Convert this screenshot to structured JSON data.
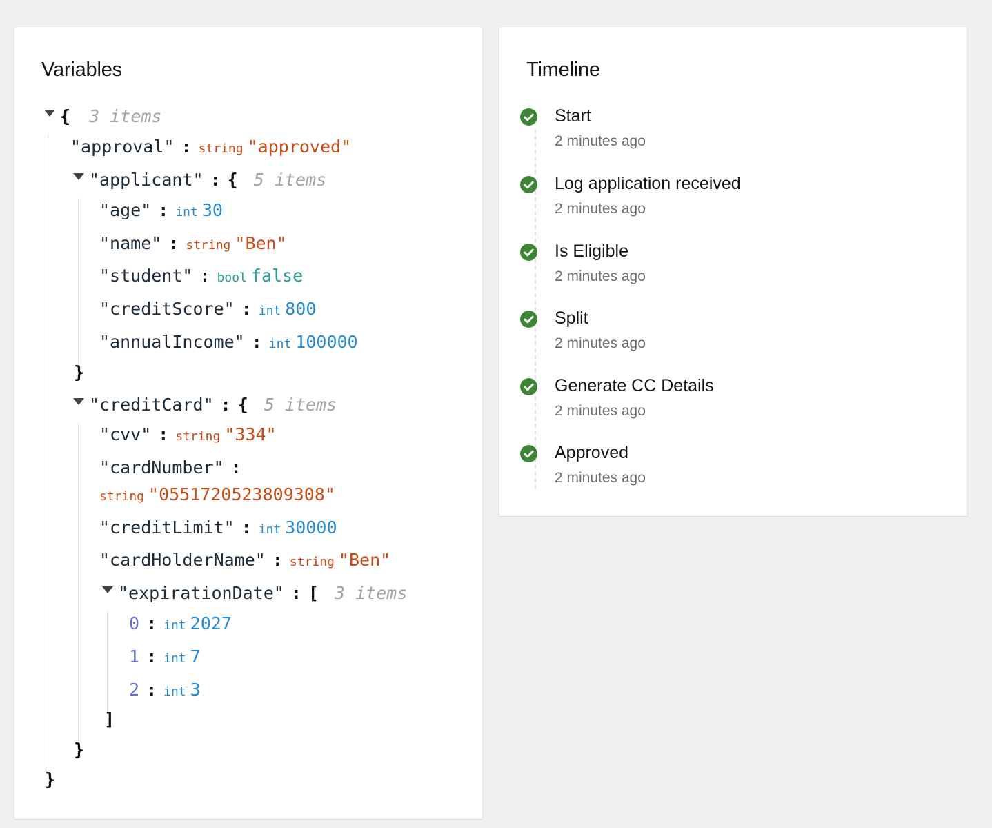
{
  "variables": {
    "title": "Variables",
    "root_count": "3 items",
    "approval": {
      "key": "\"approval\"",
      "type": "string",
      "value": "\"approved\""
    },
    "applicant": {
      "key": "\"applicant\"",
      "count": "5 items",
      "fields": [
        {
          "key": "\"age\"",
          "type": "int",
          "value": "30"
        },
        {
          "key": "\"name\"",
          "type": "string",
          "value": "\"Ben\""
        },
        {
          "key": "\"student\"",
          "type": "bool",
          "value": "false"
        },
        {
          "key": "\"creditScore\"",
          "type": "int",
          "value": "800"
        },
        {
          "key": "\"annualIncome\"",
          "type": "int",
          "value": "100000"
        }
      ]
    },
    "creditCard": {
      "key": "\"creditCard\"",
      "count": "5 items",
      "fields": [
        {
          "key": "\"cvv\"",
          "type": "string",
          "value": "\"334\""
        },
        {
          "key": "\"cardNumber\"",
          "type": "string",
          "value": "\"0551720523809308\""
        },
        {
          "key": "\"creditLimit\"",
          "type": "int",
          "value": "30000"
        },
        {
          "key": "\"cardHolderName\"",
          "type": "string",
          "value": "\"Ben\""
        }
      ],
      "expirationDate": {
        "key": "\"expirationDate\"",
        "count": "3 items",
        "items": [
          {
            "index": "0",
            "type": "int",
            "value": "2027"
          },
          {
            "index": "1",
            "type": "int",
            "value": "7"
          },
          {
            "index": "2",
            "type": "int",
            "value": "3"
          }
        ]
      }
    }
  },
  "timeline": {
    "title": "Timeline",
    "status_icon": "check-circle-icon",
    "success_color": "#3e8635",
    "items": [
      {
        "label": "Start",
        "time": "2 minutes ago"
      },
      {
        "label": "Log application received",
        "time": "2 minutes ago"
      },
      {
        "label": "Is Eligible",
        "time": "2 minutes ago"
      },
      {
        "label": "Split",
        "time": "2 minutes ago"
      },
      {
        "label": "Generate CC Details",
        "time": "2 minutes ago"
      },
      {
        "label": "Approved",
        "time": "2 minutes ago"
      }
    ]
  }
}
